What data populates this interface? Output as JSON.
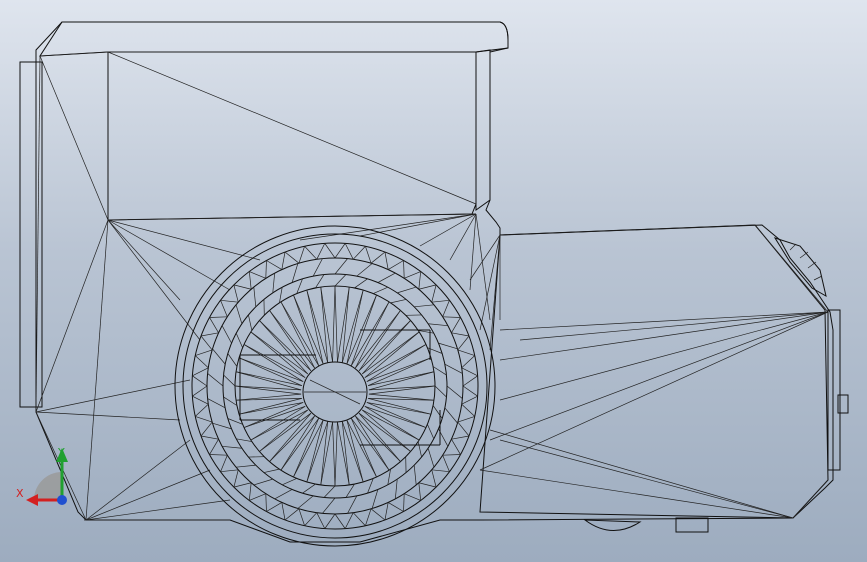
{
  "viewport": {
    "background_top": "#dfe5ee",
    "background_bottom": "#9dacbf",
    "model_face_color": "#c2c1b5",
    "wheel_rim_color": "#b8c6d8",
    "edge_color": "#111111"
  },
  "triad": {
    "x_label": "X",
    "y_label": "Y",
    "x_color": "#d32020",
    "y_color": "#20a030",
    "z_color": "#2050d0"
  }
}
